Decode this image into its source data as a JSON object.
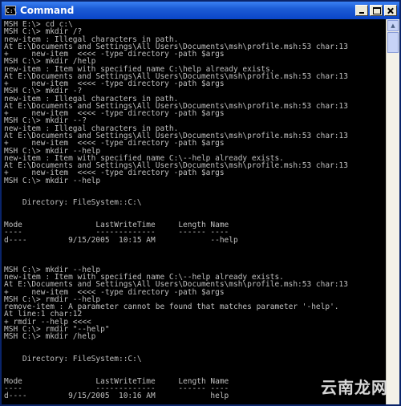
{
  "window": {
    "title": "Command",
    "icon": "console-icon"
  },
  "console_lines": [
    "MSH E:\\> cd c:\\",
    "MSH C:\\> mkdir /?",
    "new-item : Illegal characters in path.",
    "At E:\\Documents and Settings\\All Users\\Documents\\msh\\profile.msh:53 char:13",
    "+     new-item  <<<< -type directory -path $args",
    "MSH C:\\> mkdir /help",
    "new-item : Item with specified name C:\\help already exists.",
    "At E:\\Documents and Settings\\All Users\\Documents\\msh\\profile.msh:53 char:13",
    "+     new-item  <<<< -type directory -path $args",
    "MSH C:\\> mkdir -?",
    "new-item : Illegal characters in path.",
    "At E:\\Documents and Settings\\All Users\\Documents\\msh\\profile.msh:53 char:13",
    "+     new-item  <<<< -type directory -path $args",
    "MSH C:\\> mkdir --?",
    "new-item : Illegal characters in path.",
    "At E:\\Documents and Settings\\All Users\\Documents\\msh\\profile.msh:53 char:13",
    "+     new-item  <<<< -type directory -path $args",
    "MSH C:\\> mkdir --help",
    "new-item : Item with specified name C:\\--help already exists.",
    "At E:\\Documents and Settings\\All Users\\Documents\\msh\\profile.msh:53 char:13",
    "+     new-item  <<<< -type directory -path $args",
    "MSH C:\\> mkdir --help",
    "",
    "",
    "    Directory: FileSystem::C:\\",
    "",
    "",
    "Mode                LastWriteTime     Length Name",
    "----                -------------     ------ ----",
    "d----         9/15/2005  10:15 AM            --help",
    "",
    "",
    "",
    "MSH C:\\> mkdir --help",
    "new-item : Item with specified name C:\\--help already exists.",
    "At E:\\Documents and Settings\\All Users\\Documents\\msh\\profile.msh:53 char:13",
    "+     new-item  <<<< -type directory -path $args",
    "MSH C:\\> rmdir --help",
    "remove-item : A parameter cannot be found that matches parameter '-help'.",
    "At line:1 char:12",
    "+ rmdir --help <<<<",
    "MSH C:\\> rmdir \"--help\"",
    "MSH C:\\> mkdir /help",
    "",
    "",
    "    Directory: FileSystem::C:\\",
    "",
    "",
    "Mode                LastWriteTime     Length Name",
    "----                -------------     ------ ----",
    "d----         9/15/2005  10:16 AM            help",
    ""
  ],
  "watermark": "云南龙网"
}
